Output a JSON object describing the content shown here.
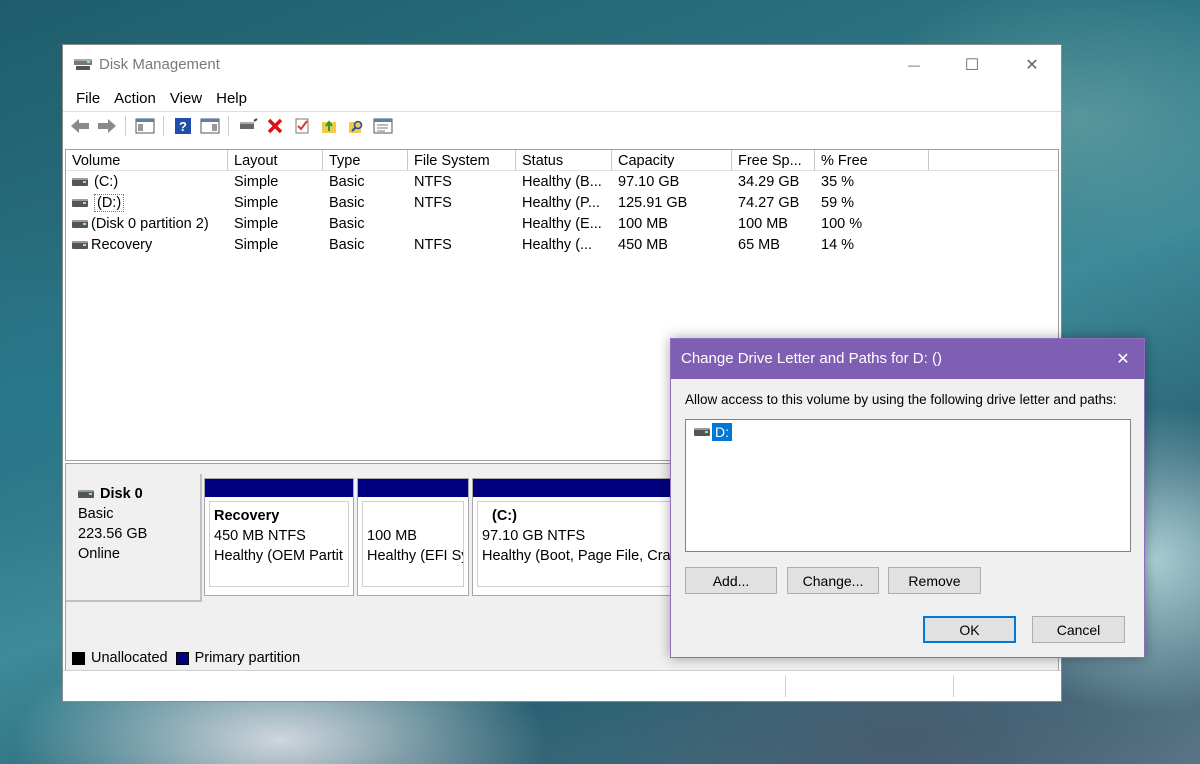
{
  "window": {
    "title": "Disk Management",
    "controls": {
      "minimize": "—",
      "maximize": "☐",
      "close": "✕"
    }
  },
  "menu": [
    "File",
    "Action",
    "View",
    "Help"
  ],
  "toolbar": {
    "icons": [
      "back-arrow-icon",
      "forward-arrow-icon",
      "show-hide-console-tree-icon",
      "help-icon",
      "show-hide-action-pane-icon",
      "connect-drive-icon",
      "delete-icon",
      "properties-icon",
      "export-folder-icon",
      "search-folder-icon",
      "console-icon"
    ]
  },
  "volume_table": {
    "headers": [
      "Volume",
      "Layout",
      "Type",
      "File System",
      "Status",
      "Capacity",
      "Free Sp...",
      "% Free"
    ],
    "rows": [
      [
        "(C:)",
        "Simple",
        "Basic",
        "NTFS",
        "Healthy (B...",
        "97.10 GB",
        "34.29 GB",
        "35 %"
      ],
      [
        "(D:)",
        "Simple",
        "Basic",
        "NTFS",
        "Healthy (P...",
        "125.91 GB",
        "74.27 GB",
        "59 %"
      ],
      [
        "(Disk 0 partition 2)",
        "Simple",
        "Basic",
        "",
        "Healthy (E...",
        "100 MB",
        "100 MB",
        "100 %"
      ],
      [
        "Recovery",
        "Simple",
        "Basic",
        "NTFS",
        "Healthy (...",
        "450 MB",
        "65 MB",
        "14 %"
      ]
    ]
  },
  "disk": {
    "name": "Disk 0",
    "type": "Basic",
    "size": "223.56 GB",
    "state": "Online",
    "partitions": [
      {
        "name": "Recovery",
        "size": "450 MB NTFS",
        "status": "Healthy (OEM Partit"
      },
      {
        "name": "",
        "size": "100 MB",
        "status": "Healthy (EFI Sy"
      },
      {
        "name": "(C:)",
        "size": "97.10 GB NTFS",
        "status": "Healthy (Boot, Page File, Cra"
      }
    ]
  },
  "legend": {
    "unallocated": "Unallocated",
    "primary": "Primary partition"
  },
  "colors": {
    "primary_partition": "#000080",
    "unallocated": "#000000",
    "dialog_title": "#7f5fb4",
    "selection": "#0078d7"
  },
  "dialog": {
    "title": "Change Drive Letter and Paths for D: ()",
    "close": "✕",
    "label": "Allow access to this volume by using the following drive letter and paths:",
    "items": [
      "D:"
    ],
    "buttons": {
      "add": "Add...",
      "change": "Change...",
      "remove": "Remove",
      "ok": "OK",
      "cancel": "Cancel"
    }
  }
}
